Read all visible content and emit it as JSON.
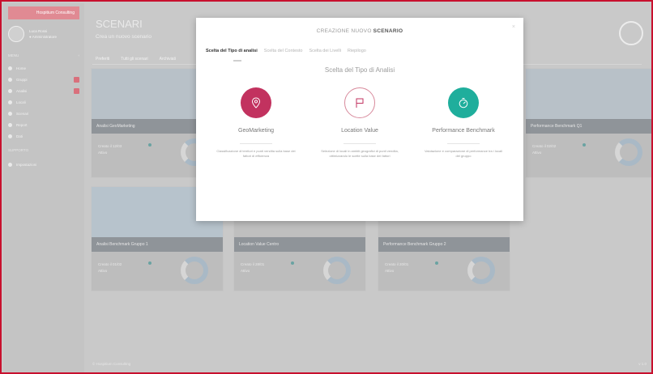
{
  "app": {
    "brand_label": "Hospitium Consulting",
    "user_name": "Luca Rossi",
    "user_status": "● Amministratore"
  },
  "sidebar": {
    "section_label": "MENU",
    "items": [
      {
        "label": "Home",
        "badge": false
      },
      {
        "label": "Gruppi",
        "badge": true
      },
      {
        "label": "Analisi",
        "badge": true
      },
      {
        "label": "Locali",
        "badge": false
      },
      {
        "label": "Scenari",
        "badge": false
      },
      {
        "label": "Report",
        "badge": false
      },
      {
        "label": "Dati",
        "badge": false
      }
    ],
    "sep_label": "SUPPORTO",
    "extra_item": "Impostazioni"
  },
  "main": {
    "title": "SCENARI",
    "subtitle": "Crea un nuovo scenario",
    "tabs": [
      "Preferiti",
      "Tutti gli scenari",
      "Archiviati"
    ],
    "cards": [
      {
        "title": "Analisi GeoMarketing",
        "meta1": "Creato il 12/03",
        "meta2": "Attivo"
      },
      {
        "title": "Performance Benchmark Q1",
        "meta1": "Creato il 02/02",
        "meta2": "Attivo"
      },
      {
        "title": "Analisi Benchmark Gruppo 1",
        "meta1": "Creato il 01/02",
        "meta2": "Attivo"
      },
      {
        "title": "Location Value Centro",
        "meta1": "Creato il 28/01",
        "meta2": "Attivo"
      },
      {
        "title": "Performance Benchmark Gruppo 2",
        "meta1": "Creato il 20/01",
        "meta2": "Attivo"
      }
    ],
    "footer_left": "© Hospitium Consulting",
    "footer_right": "v 1.0"
  },
  "modal": {
    "header_prefix": "CREAZIONE NUOVO",
    "header_bold": "SCENARIO",
    "close_glyph": "×",
    "tabs": [
      "Scelta del Tipo di analisi",
      "Scelta del Contesto",
      "Scelta dei Livelli",
      "Riepilogo"
    ],
    "section_title": "Scelta del Tipo di Analisi",
    "options": [
      {
        "name": "GeoMarketing",
        "desc": "Classificazione di territori e punti vendita sulla base dei fattori di efficienza",
        "color": "#c2325f"
      },
      {
        "name": "Location Value",
        "desc": "Selezione di locali in ambiti geografici di punti vendita, ottimizzando le scelte sulla base dei fattori",
        "color": "#ffffff"
      },
      {
        "name": "Performance Benchmark",
        "desc": "Valutazione e comparazione di performance tra i locali del gruppo",
        "color": "#1fae9c"
      }
    ]
  }
}
